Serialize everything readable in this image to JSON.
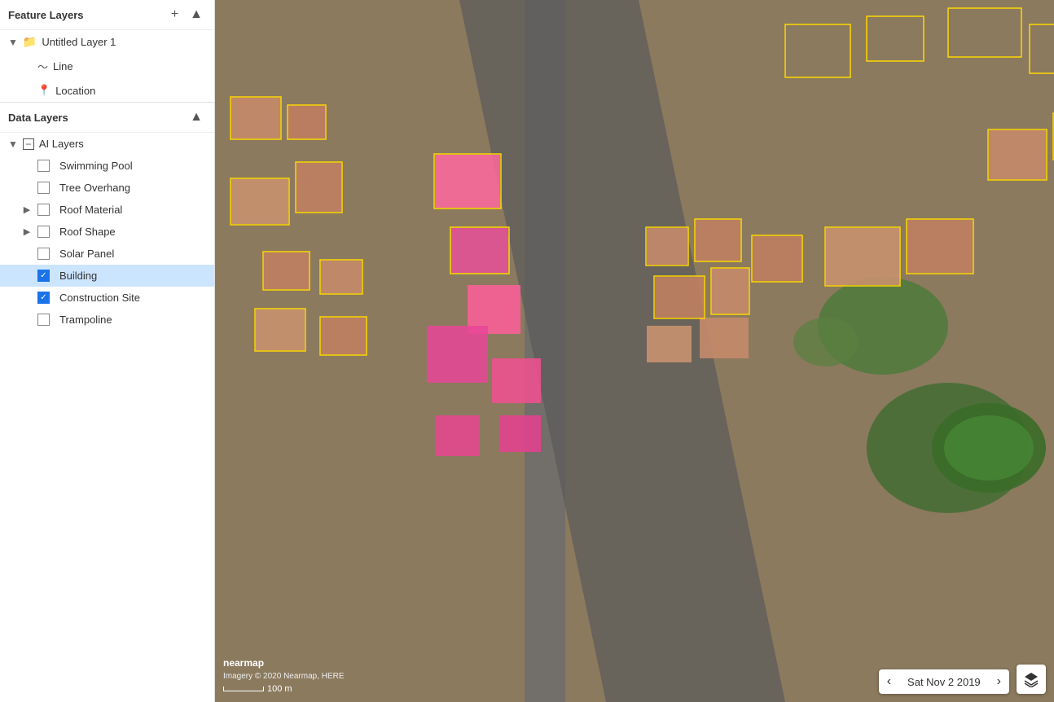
{
  "sidebar": {
    "feature_layers_label": "Feature Layers",
    "add_icon": "+",
    "collapse_icon": "▲",
    "untitled_layer": "Untitled Layer 1",
    "line_item": "Line",
    "location_item": "Location",
    "data_layers_label": "Data Layers",
    "ai_layers_label": "AI Layers",
    "items": [
      {
        "id": "swimming-pool",
        "label": "Swimming Pool",
        "checked": false,
        "expandable": false
      },
      {
        "id": "tree-overhang",
        "label": "Tree Overhang",
        "checked": false,
        "expandable": false
      },
      {
        "id": "roof-material",
        "label": "Roof Material",
        "checked": false,
        "expandable": true
      },
      {
        "id": "roof-shape",
        "label": "Roof Shape",
        "checked": false,
        "expandable": true
      },
      {
        "id": "solar-panel",
        "label": "Solar Panel",
        "checked": false,
        "expandable": false
      },
      {
        "id": "building",
        "label": "Building",
        "checked": true,
        "expandable": false,
        "selected": true
      },
      {
        "id": "construction-site",
        "label": "Construction Site",
        "checked": true,
        "expandable": false
      },
      {
        "id": "trampoline",
        "label": "Trampoline",
        "checked": false,
        "expandable": false
      }
    ]
  },
  "map": {
    "date_label": "Sat Nov 2 2019",
    "attribution": "Imagery © 2020 Nearmap, HERE",
    "scale_label": "100 m",
    "nearmap_label": "nearmap"
  }
}
